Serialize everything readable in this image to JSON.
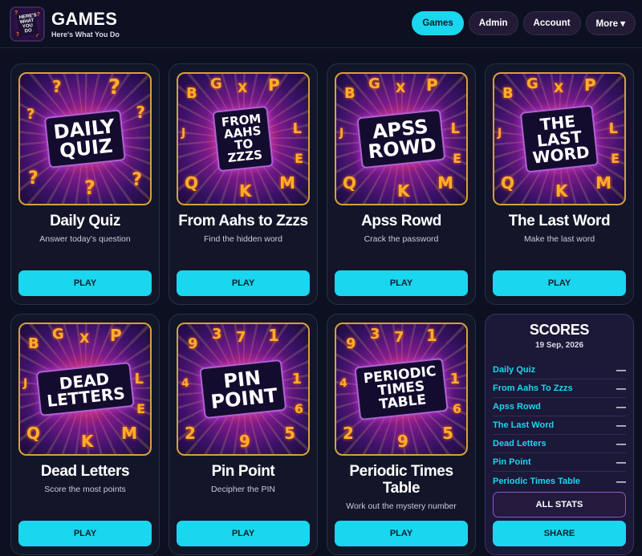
{
  "header": {
    "logo_text": "HERE'S WHAT YOU DO",
    "title": "GAMES",
    "subtitle": "Here's What You Do",
    "nav": [
      "Games",
      "Admin",
      "Account",
      "More ▾"
    ]
  },
  "games": [
    {
      "art": "DAILY\nQUIZ",
      "title": "Daily Quiz",
      "desc": "Answer today's question",
      "play": "PLAY"
    },
    {
      "art": "FROM\nAAHS\nTO\nZZZS",
      "title": "From Aahs to Zzzs",
      "desc": "Find the hidden word",
      "play": "PLAY"
    },
    {
      "art": "APSS\nROWD",
      "title": "Apss Rowd",
      "desc": "Crack the password",
      "play": "PLAY"
    },
    {
      "art": "THE\nLAST\nWORD",
      "title": "The Last Word",
      "desc": "Make the last word",
      "play": "PLAY"
    },
    {
      "art": "DEAD\nLETTERS",
      "title": "Dead Letters",
      "desc": "Score the most points",
      "play": "PLAY"
    },
    {
      "art": "PIN\nPOINT",
      "title": "Pin Point",
      "desc": "Decipher the PIN",
      "play": "PLAY"
    },
    {
      "art": "PERIODIC\nTIMES\nTABLE",
      "title": "Periodic Times Table",
      "desc": "Work out the mystery number",
      "play": "PLAY"
    }
  ],
  "scores": {
    "title": "SCORES",
    "date": "19 Sep, 2026",
    "rows": [
      {
        "name": "Daily Quiz",
        "value": "—"
      },
      {
        "name": "From Aahs To Zzzs",
        "value": "—"
      },
      {
        "name": "Apss Rowd",
        "value": "—"
      },
      {
        "name": "The Last Word",
        "value": "—"
      },
      {
        "name": "Dead Letters",
        "value": "—"
      },
      {
        "name": "Pin Point",
        "value": "—"
      },
      {
        "name": "Periodic Times Table",
        "value": "—"
      }
    ],
    "all_stats": "ALL STATS",
    "share": "SHARE"
  }
}
